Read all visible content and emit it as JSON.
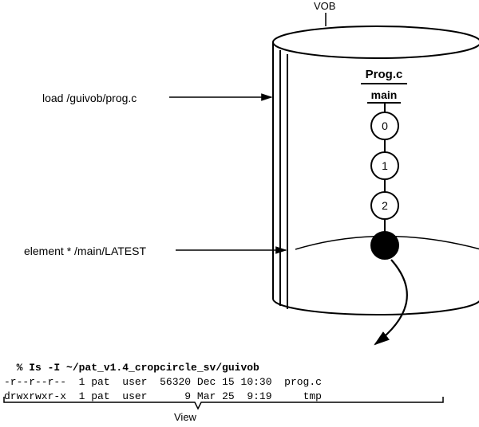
{
  "labels": {
    "vob": "VOB",
    "load": "load /guivob/prog.c",
    "configspec": "element * /main/LATEST",
    "view": "View",
    "prog": "Prog.c",
    "main": "main"
  },
  "versions": [
    "0",
    "1",
    "2"
  ],
  "terminal": {
    "command": "% Is -I ~/pat_v1.4_cropcircle_sv/guivob",
    "rows": [
      {
        "perm": "-r--r--r--",
        "links": "1",
        "owner": "pat",
        "group": "user",
        "size": "56320",
        "date": "Dec 15 10:30",
        "name": "prog.c"
      },
      {
        "perm": "drwxrwxr-x",
        "links": "1",
        "owner": "pat",
        "group": "user",
        "size": "9",
        "date": "Mar 25  9:19",
        "name": "tmp"
      }
    ]
  }
}
